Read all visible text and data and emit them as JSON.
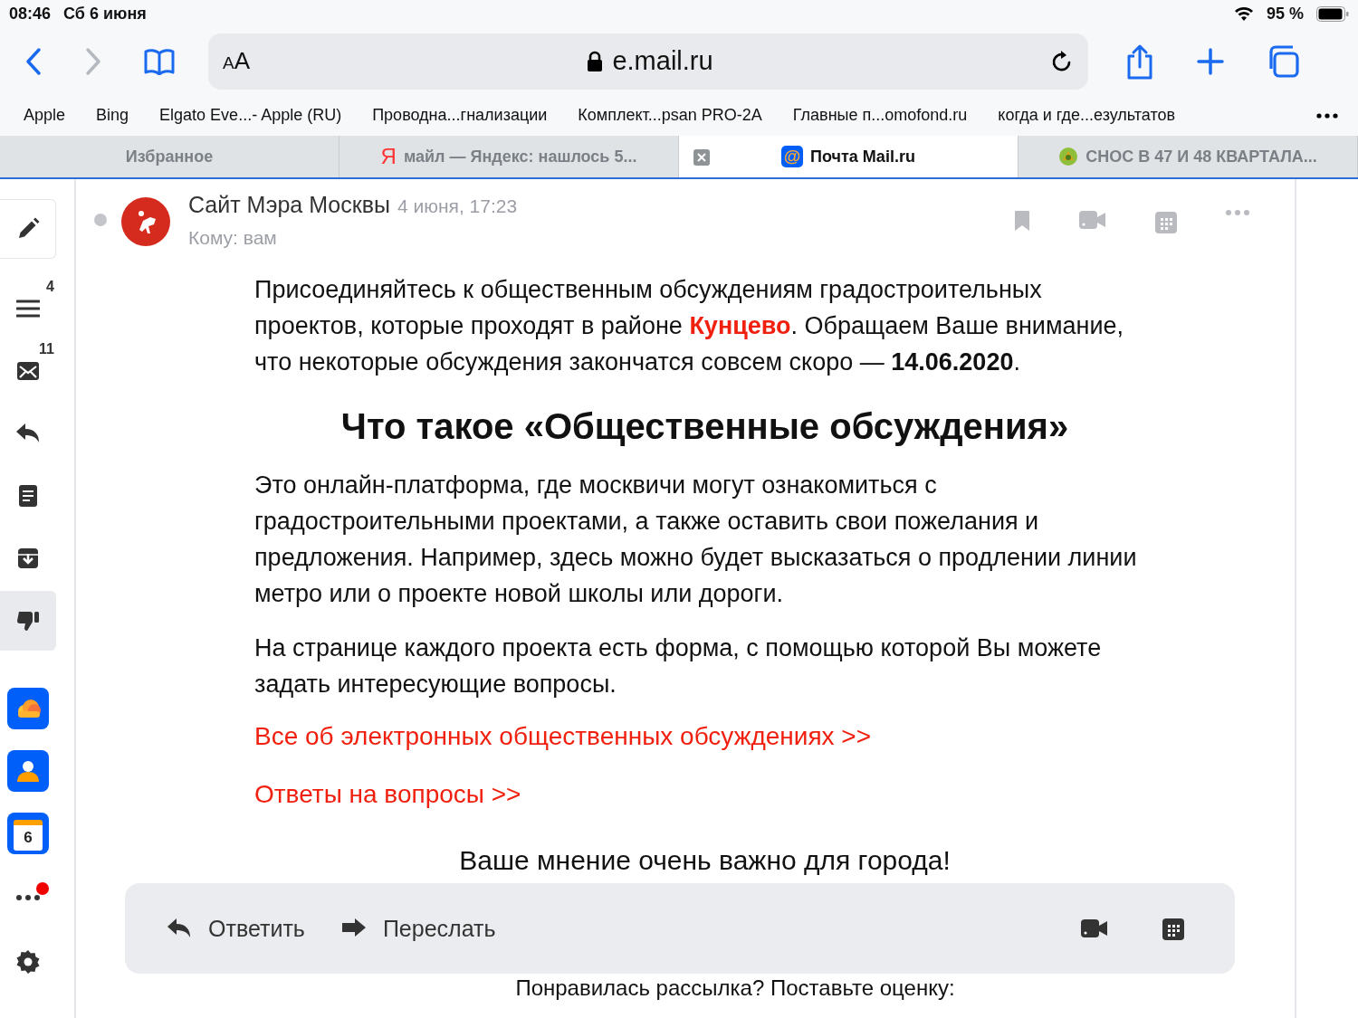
{
  "status_bar": {
    "time": "08:46",
    "date": "Сб 6 июня",
    "battery_text": "95 %"
  },
  "toolbar": {
    "nav_buttons": [
      {
        "kind": "back",
        "disabled": false
      },
      {
        "kind": "forward",
        "disabled": true
      }
    ],
    "text_size_label": "AA",
    "address": "e.mail.ru"
  },
  "bookmarks": [
    "Apple",
    "Bing",
    "Elgato Eve...- Apple (RU)",
    "Проводна...гнализации",
    "Комплект...psan PRO-2A",
    "Главные п...omofond.ru",
    "когда и где...езультатов"
  ],
  "tabs": [
    {
      "title": "Избранное",
      "selected": false
    },
    {
      "title": "майл — Яндекс: нашлось 5...",
      "selected": false,
      "icon": {
        "kind": "letter",
        "text": "Я"
      }
    },
    {
      "title": "Почта Mail.ru",
      "selected": true,
      "icon": {
        "kind": "badge",
        "text": "@"
      }
    },
    {
      "title": "СНОС В 47 И 48 КВАРТАЛА...",
      "selected": false,
      "icon": {
        "kind": "picture"
      }
    }
  ],
  "sidebar": {
    "items": [
      {
        "kind": "compose",
        "selected": false,
        "alert": false
      },
      {
        "kind": "menu",
        "badge": "4",
        "selected": false,
        "alert": false
      },
      {
        "kind": "inbox",
        "badge": "11",
        "selected": false,
        "alert": false
      },
      {
        "kind": "reply",
        "selected": false,
        "alert": false
      },
      {
        "kind": "note",
        "selected": false,
        "alert": false
      },
      {
        "kind": "archive",
        "selected": false,
        "alert": false
      },
      {
        "kind": "spam",
        "selected": true,
        "alert": false
      },
      {
        "kind": "cloud",
        "selected": false,
        "alert": false
      },
      {
        "kind": "contacts",
        "selected": false,
        "alert": false
      },
      {
        "kind": "calendar",
        "icon_text": "6",
        "selected": false,
        "alert": false
      },
      {
        "kind": "more",
        "selected": false,
        "alert": true
      },
      {
        "kind": "settings",
        "selected": false,
        "alert": false
      }
    ]
  },
  "message": {
    "sender": "Сайт Мэра Москвы",
    "date": "4 июня, 17:23",
    "recipient": "Кому: вам",
    "unread": false,
    "body": [
      {
        "kind": "paragraph",
        "parts": [
          {
            "kind": "plain",
            "text": "Присоединяйтесь к общественным обсуждениям градостроительных проектов, которые проходят в районе "
          },
          {
            "kind": "highlight",
            "text": "Кунцево"
          },
          {
            "kind": "plain",
            "text": ". Обращаем Ваше внимание, что некоторые обсуждения закончатся совсем скоро — "
          },
          {
            "kind": "bold",
            "text": "14.06.2020"
          },
          {
            "kind": "plain",
            "text": "."
          }
        ]
      },
      {
        "kind": "heading",
        "text": "Что такое «Общественные обсуждения»"
      },
      {
        "kind": "paragraph",
        "parts": [
          {
            "kind": "plain",
            "text": "Это онлайн-платформа, где москвичи могут ознакомиться с градостроительными проектами, а также оставить свои пожелания и предложения. Например, здесь можно будет высказаться о продлении линии метро или о проекте новой школы или дороги."
          }
        ]
      },
      {
        "kind": "paragraph",
        "parts": [
          {
            "kind": "plain",
            "text": "На странице каждого проекта есть форма, с помощью которой Вы можете задать интересующие вопросы."
          }
        ]
      },
      {
        "kind": "link",
        "text": "Все об электронных общественных обсуждениях >>"
      },
      {
        "kind": "link",
        "text": "Ответы на вопросы >>"
      },
      {
        "kind": "center",
        "text": "Ваше мнение очень важно для города!"
      }
    ],
    "after_bar": "Понравилась рассылка? Поставьте оценку:"
  },
  "reply_bar": {
    "buttons": [
      {
        "kind": "reply",
        "label": "Ответить"
      },
      {
        "kind": "forward",
        "label": "Переслать"
      }
    ]
  }
}
